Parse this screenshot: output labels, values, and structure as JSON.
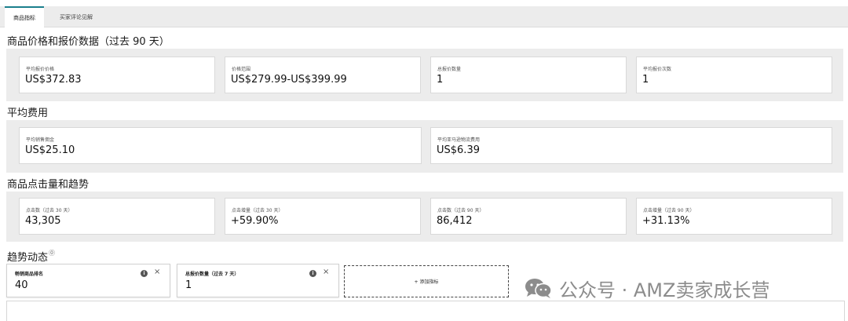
{
  "tabs": [
    {
      "label": "商品指标",
      "active": true
    },
    {
      "label": "买家评论见解",
      "active": false
    }
  ],
  "sections": {
    "price": {
      "title": "商品价格和报价数据（过去 90 天）",
      "cards": [
        {
          "label": "平均报价价格",
          "value": "US$372.83"
        },
        {
          "label": "价格范围",
          "value": "US$279.99-US$399.99"
        },
        {
          "label": "总报价数量",
          "value": "1"
        },
        {
          "label": "平均报价次数",
          "value": "1"
        }
      ]
    },
    "fees": {
      "title": "平均费用",
      "cards": [
        {
          "label": "平均销售佣金",
          "value": "US$25.10"
        },
        {
          "label": "平均亚马逊物流费用",
          "value": "US$6.39"
        }
      ]
    },
    "clicks": {
      "title": "商品点击量和趋势",
      "cards": [
        {
          "label": "点击数（过去 30 天）",
          "value": "43,305"
        },
        {
          "label": "点击增量（过去 30 天）",
          "value": "+59.90%"
        },
        {
          "label": "点击数（过去 90 天）",
          "value": "86,412"
        },
        {
          "label": "点击增量（过去 90 天）",
          "value": "+31.13%"
        }
      ]
    },
    "trends": {
      "title": "趋势动态",
      "help_glyph": "⓪",
      "cards": [
        {
          "label": "畅销商品排名",
          "value": "40"
        },
        {
          "label": "总报价数量（过去 7 天）",
          "value": "1"
        }
      ],
      "info_glyph": "i",
      "close_glyph": "×",
      "add_label": "+ 添加指标"
    }
  },
  "watermark": {
    "text": "公众号 · AMZ卖家成长营",
    "icon": "wechat-icon"
  },
  "colors": {
    "accent": "#1a7f8c",
    "panel_bg": "#ececec",
    "watermark": "#8c8c8c"
  }
}
